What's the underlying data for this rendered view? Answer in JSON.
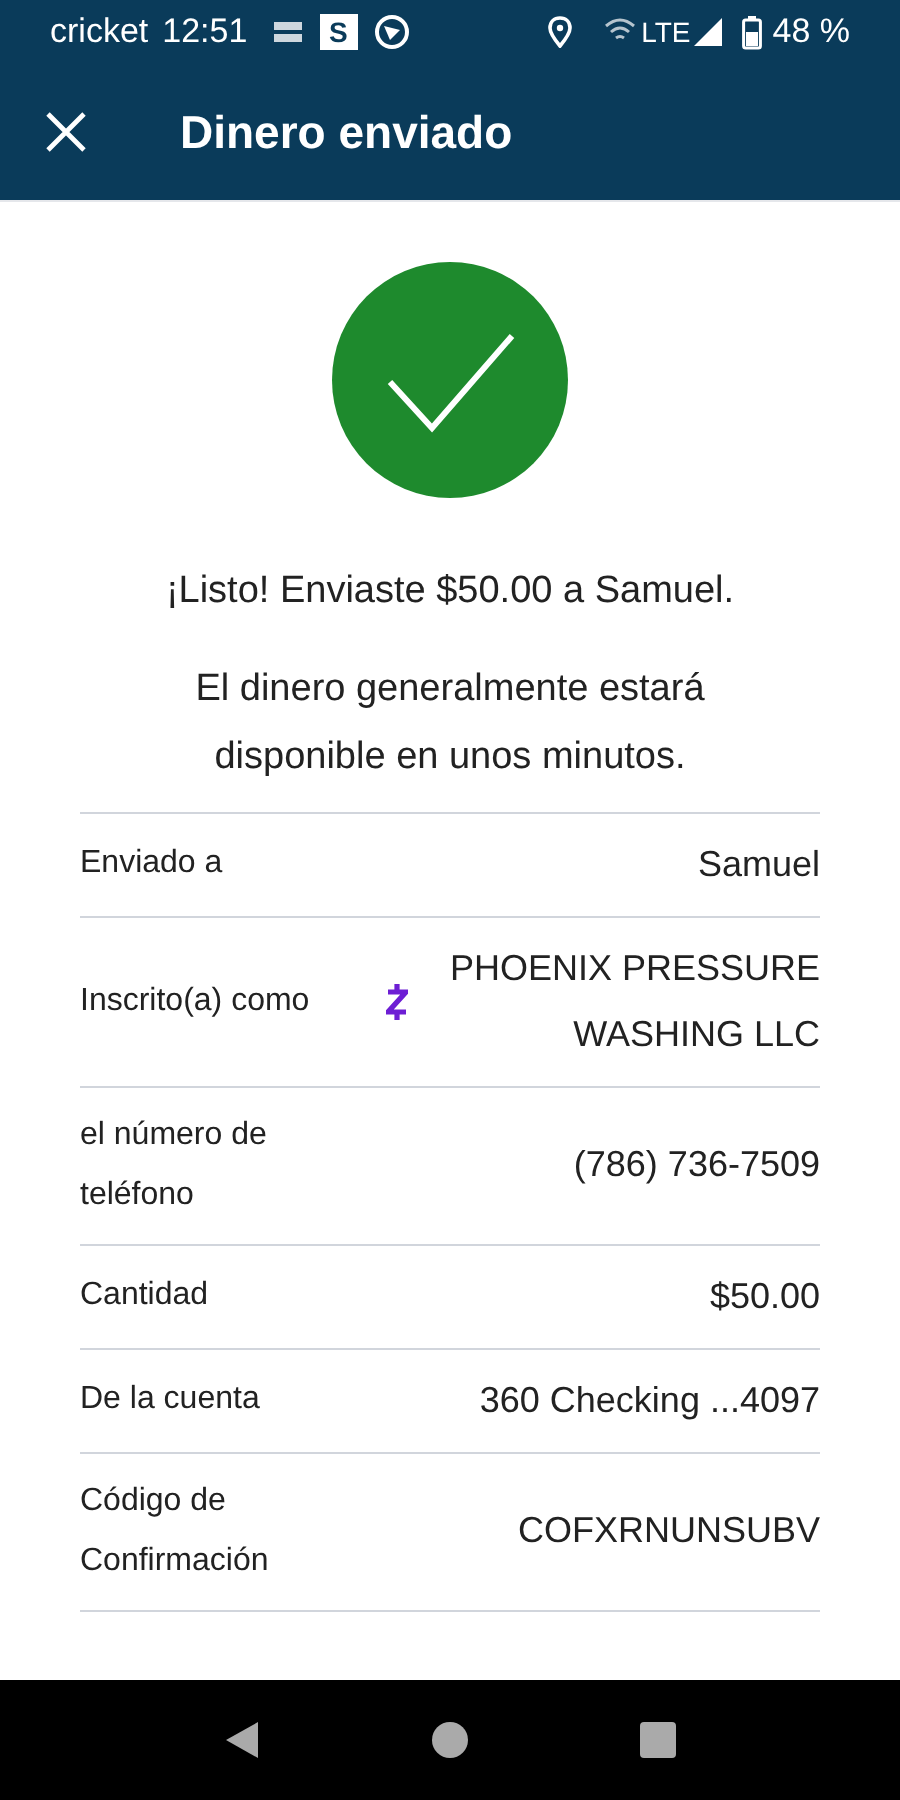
{
  "status_bar": {
    "carrier": "cricket",
    "time": "12:51",
    "app_letter": "S",
    "network": "LTE",
    "battery": "48 %"
  },
  "header": {
    "title": "Dinero enviado"
  },
  "message": "¡Listo! Enviaste $50.00 a Samuel.",
  "note": "El dinero generalmente estará disponible en unos minutos.",
  "details": [
    {
      "kind": "plain",
      "label": "Enviado a",
      "value": "Samuel"
    },
    {
      "kind": "badge",
      "label": "Inscrito(a) como",
      "value": "PHOENIX PRESSURE WASHING LLC"
    },
    {
      "kind": "plain",
      "label": "el número de teléfono",
      "value": "(786) 736-7509"
    },
    {
      "kind": "plain",
      "label": "Cantidad",
      "value": "$50.00"
    },
    {
      "kind": "plain",
      "label": "De la cuenta",
      "value": "360 Checking ...4097"
    },
    {
      "kind": "plain",
      "label": "Código de Confirmación",
      "value": "COFXRNUNSUBV"
    }
  ]
}
